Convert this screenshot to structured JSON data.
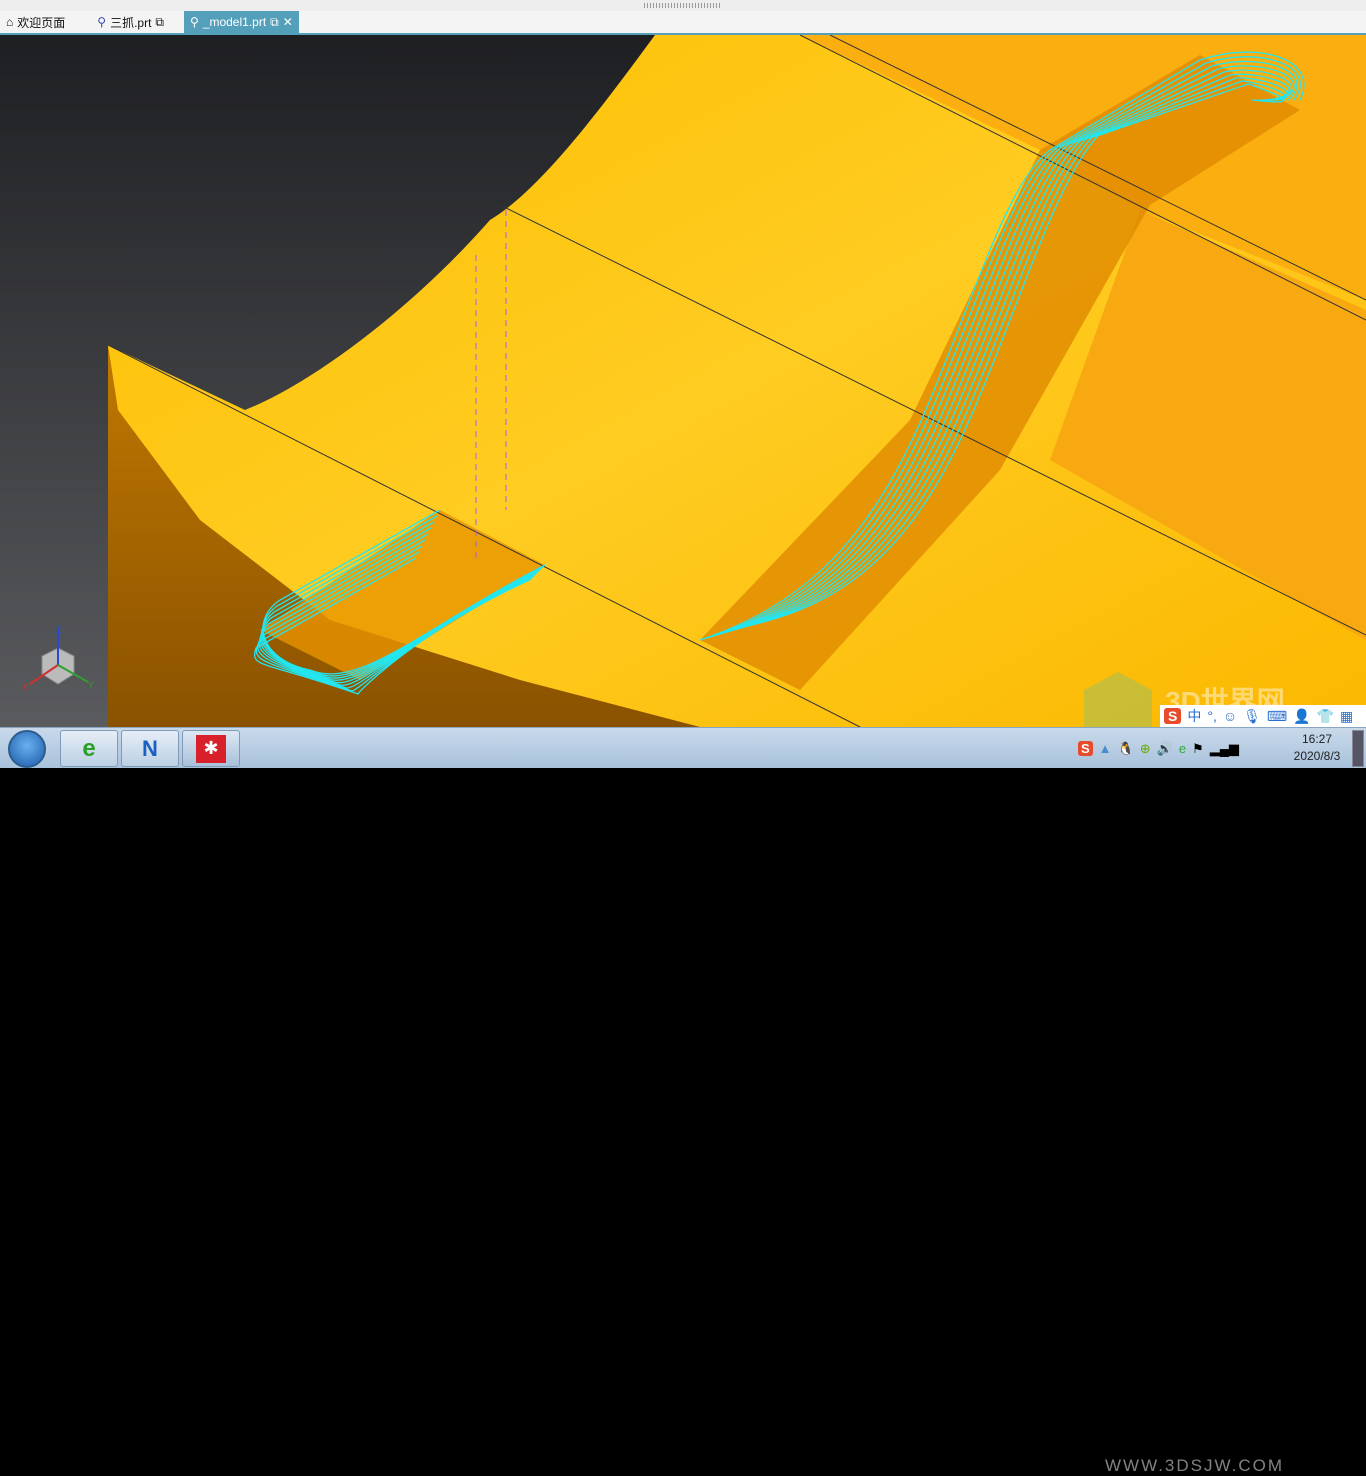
{
  "tabs": [
    {
      "label": "欢迎页面",
      "icon": "home-icon",
      "active": false
    },
    {
      "label": "三抓.prt",
      "icon": "part-file-icon",
      "active": false
    },
    {
      "label": "_model1.prt",
      "icon": "part-file-icon",
      "active": true
    }
  ],
  "triad": {
    "x": "X",
    "y": "Y",
    "z": "Z"
  },
  "watermark": {
    "title": "3D世界网",
    "url": "WWW.3DSJW.COM"
  },
  "ime": {
    "mode": "中",
    "punct": "°,",
    "icons": [
      "smiley-icon",
      "microphone-icon",
      "keyboard-icon",
      "user-icon",
      "skin-icon",
      "grid-icon"
    ]
  },
  "tray": {
    "icons": [
      "sogou-icon",
      "show-hidden-icon",
      "qq-icon",
      "360-icon",
      "volume-icon",
      "ie-icon",
      "flag-icon",
      "network-icon"
    ]
  },
  "clock": {
    "time": "16:27",
    "date": "2020/8/3"
  },
  "colors": {
    "accent": "#54a0bb",
    "toolpath": "#22e6f0",
    "surface": "#fdc300"
  }
}
